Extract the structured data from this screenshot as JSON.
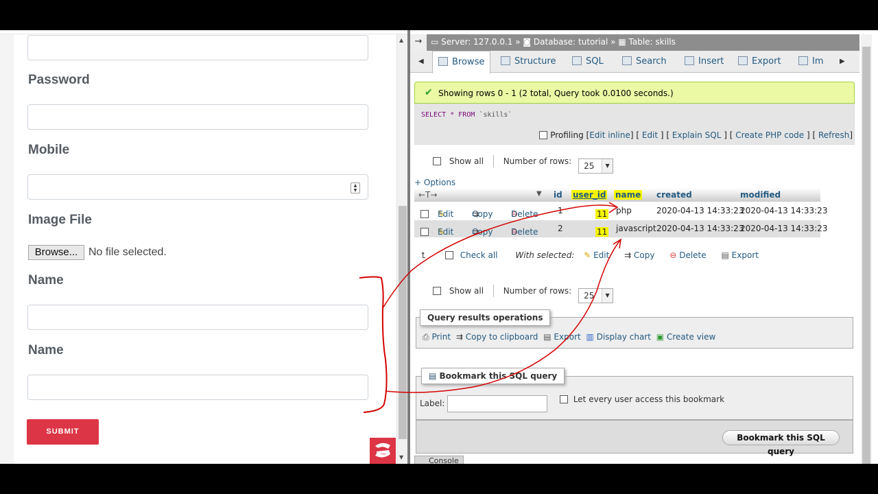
{
  "form": {
    "password_label": "Password",
    "mobile_label": "Mobile",
    "image_label": "Image File",
    "browse_label": "Browse...",
    "no_file": "No file selected.",
    "name_label_1": "Name",
    "name_label_2": "Name",
    "submit_label": "SUBMIT",
    "spinner_up": "▲",
    "spinner_down": "▼"
  },
  "pma": {
    "back_arrow": "→",
    "breadcrumb": {
      "server": "Server: 127.0.0.1",
      "database": "Database: tutorial",
      "table": "Table: skills",
      "sep": "»"
    },
    "tabs": [
      "Browse",
      "Structure",
      "SQL",
      "Search",
      "Insert",
      "Export",
      "Im"
    ],
    "tab_left_arrow": "◀",
    "tab_right_arrow": "▶",
    "success_message": "Showing rows 0 - 1 (2 total, Query took 0.0100 seconds.)",
    "sql_keyword": "SELECT * FROM",
    "sql_table": "`skills`",
    "profiling_label": "Profiling",
    "sql_links": {
      "edit_inline": "Edit inline",
      "edit": "Edit",
      "explain": "Explain SQL",
      "php": "Create PHP code",
      "refresh": "Refresh"
    },
    "show_all": "Show all",
    "number_of_rows_label": "Number of rows:",
    "rows_value": "25",
    "options_link": "+ Options",
    "columns": [
      "id",
      "user_id",
      "name",
      "created",
      "modified"
    ],
    "sort_arrows": "←T→",
    "actions": {
      "edit": "Edit",
      "copy": "Copy",
      "delete": "Delete"
    },
    "rows": [
      {
        "id": "1",
        "user_id": "11",
        "name": "php",
        "created": "2020-04-13 14:33:23",
        "modified": "2020-04-13 14:33:23"
      },
      {
        "id": "2",
        "user_id": "11",
        "name": "javascript",
        "created": "2020-04-13 14:33:23",
        "modified": "2020-04-13 14:33:23"
      }
    ],
    "check_all": "Check all",
    "with_selected": "With selected:",
    "bulk": {
      "edit": "Edit",
      "copy": "Copy",
      "delete": "Delete",
      "export": "Export"
    },
    "query_ops_title": "Query results operations",
    "query_ops": {
      "print": "Print",
      "copy": "Copy to clipboard",
      "export": "Export",
      "chart": "Display chart",
      "view": "Create view"
    },
    "bookmark_title": "Bookmark this SQL query",
    "bookmark_label": "Label:",
    "bookmark_share": "Let every user access this bookmark",
    "bookmark_button": "Bookmark this SQL query",
    "console_label": "Console"
  },
  "colors": {
    "submit": "#dc3545",
    "link": "#235a81",
    "highlight": "#f5f500",
    "annotation": "#d40000",
    "success_bg": "#ebf8a4"
  }
}
